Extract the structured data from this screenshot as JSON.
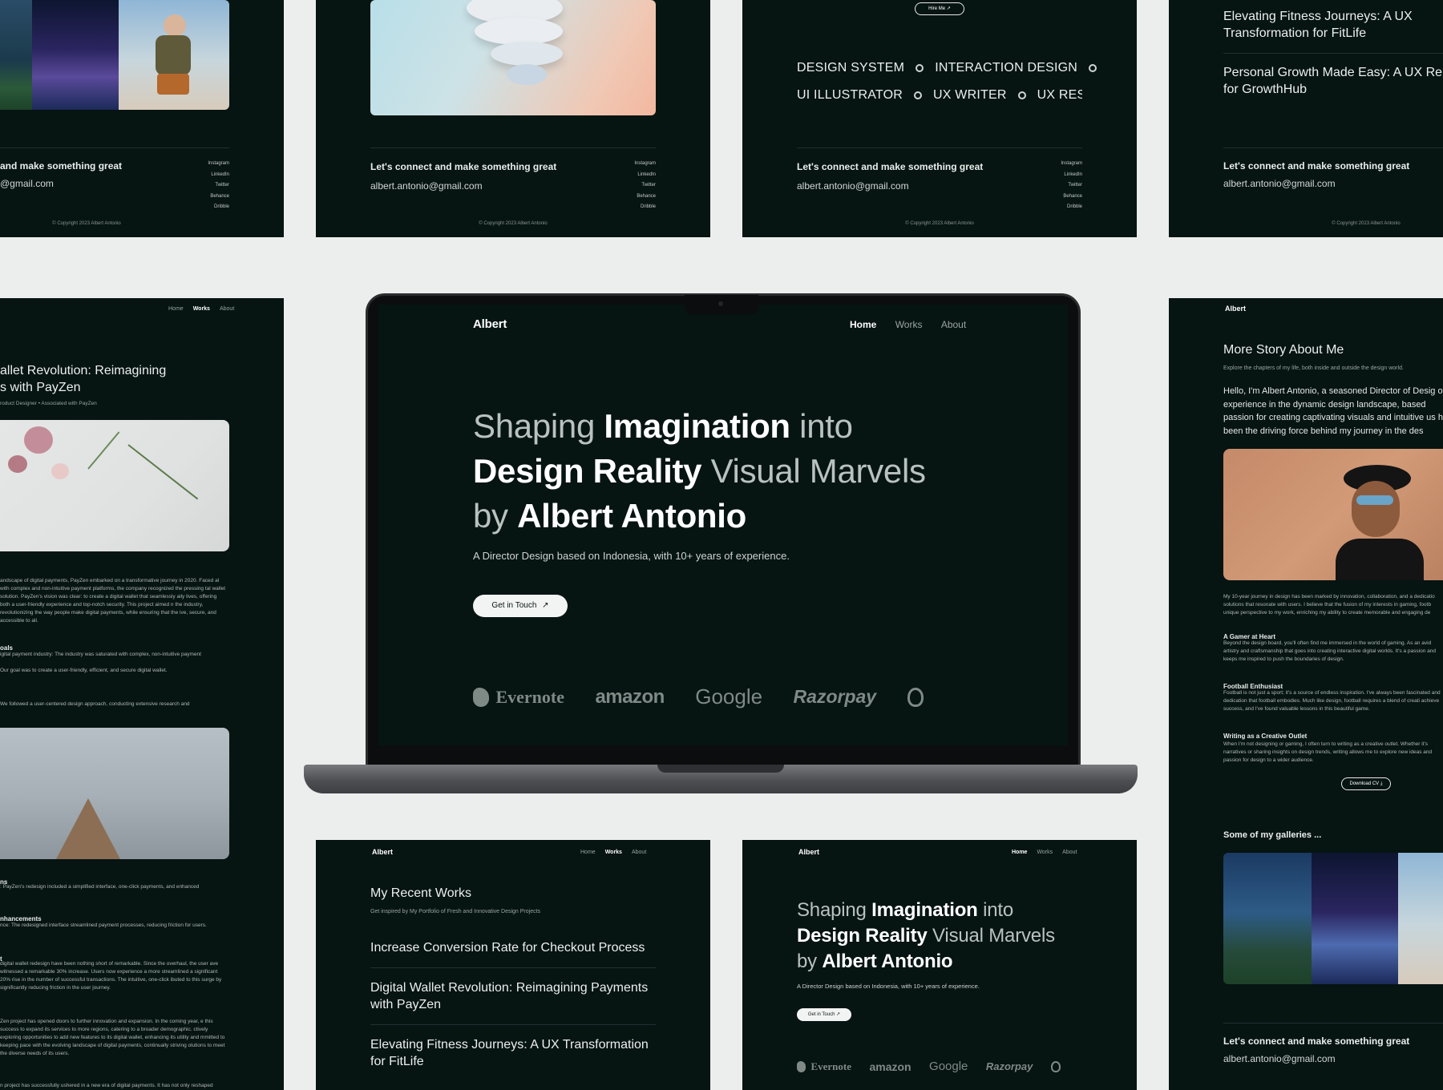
{
  "site": {
    "logo": "Albert",
    "nav": [
      "Home",
      "Works",
      "About"
    ],
    "hire_button": "Hire Me",
    "footer": {
      "cta": "Let's connect and make something great",
      "email": "albert.antonio@gmail.com",
      "social": [
        "Instagram",
        "LinkedIn",
        "Twitter",
        "Behance",
        "Dribble"
      ],
      "copyright": "© Copyright 2023 Albert Antonio"
    }
  },
  "hero": {
    "line1_a": "Shaping ",
    "line1_b": "Imagination",
    "line1_c": " into",
    "line2_a": "Design Reality",
    "line2_b": " Visual Marvels",
    "line3_a": "by ",
    "line3_b": "Albert Antonio",
    "subtitle": "A Director Design based on Indonesia, with 10+ years of experience.",
    "cta": "Get in Touch",
    "brands": [
      "Evernote",
      "amazon",
      "Google",
      "Razorpay"
    ]
  },
  "tags": {
    "row1": [
      "DESIGN SYSTEM",
      "INTERACTION DESIGN"
    ],
    "row2": [
      "UI ILLUSTRATOR",
      "UX WRITER",
      "UX RESEA"
    ]
  },
  "works": {
    "title": "My Recent Works",
    "subtitle": "Get inspired by My Portfolio of Fresh and Innovative Design Projects",
    "items": [
      "Increase Conversion Rate for Checkout Process",
      "Digital Wallet Revolution: Reimagining Payments with PayZen",
      "Elevating Fitness Journeys: A UX Transformation for FitLife"
    ]
  },
  "right_top_works": [
    "Elevating Fitness Journeys: A UX Transformation for FitLife",
    "Personal Growth Made Easy: A UX Re for GrowthHub"
  ],
  "case_study": {
    "title_l1": "allet Revolution: Reimagining",
    "title_l2": "s with PayZen",
    "meta": "roduct Designer • Associated with PayZen",
    "intro": "andscape of digital payments, PayZen embarked on a transformative journey in 2020. Faced al with complex and non-intuitive payment platforms, the company recognized the pressing tal wallet solution. PayZen's vision was clear: to create a digital wallet that seamlessly aily lives, offering both a user-friendly experience and top-notch security. This project aimed n the industry, revolutionizing the way people make digital payments, while ensuring that the ive, secure, and accessible to all.",
    "goals_h": "oals",
    "goals_1": "igital payment industry: The industry was saturated with complex, non-intuitive payment",
    "goals_2": "Our goal was to create a user-friendly, efficient, and secure digital wallet.",
    "approach": "We followed a user-centered design approach, conducting extensive research and",
    "sol_h": "ns",
    "sol_1": ": PayZen's redesign included a simplified interface, one-click payments, and enhanced",
    "enh_h": "nhancements",
    "enh_1": "nce: The redesigned interface streamlined payment processes, reducing friction for users.",
    "imp_h": "t",
    "imp_1": "digital wallet redesign have been nothing short of remarkable. Since the overhaul, the user ave witnessed a remarkable 30% increase. Users now experience a more streamlined a significant 20% rise in the number of successful transactions. The intuitive, one-click ibuted to this surge by significantly reducing friction in the user journey.",
    "fut_1": "Zen project has opened doors to further innovation and expansion. In the coming year, e this success to expand its services to more regions, catering to a broader demographic. ctively exploring opportunities to add new features to its digital wallet, enhancing its utility and mmitted to keeping pace with the evolving landscape of digital payments, continually striving olutions to meet the diverse needs of its users.",
    "end_1": "n project has successfully ushered in a new era of digital payments. It has not only reshaped"
  },
  "about": {
    "title": "More Story About Me",
    "subtitle": "Explore the chapters of my life, both inside and outside the design world.",
    "intro": "Hello, I'm Albert Antonio, a seasoned Director of Desig of experience in the dynamic design landscape, based passion for creating captivating visuals and intuitive us has been the driving force behind my journey in the des",
    "para": "My 10-year journey in design has been marked by innovation, collaboration, and a dedicatio solutions that resonate with users. I believe that the fusion of my interests in gaming, footb unique perspective to my work, enriching my ability to create memorable and engaging de",
    "gamer_h": "A Gamer at Heart",
    "gamer_p": "Beyond the design board, you'll often find me immersed in the world of gaming. As an avid artistry and craftsmanship that goes into creating interactive digital worlds. It's a passion and keeps me inspired to push the boundaries of design.",
    "foot_h": "Football Enthusiast",
    "foot_p": "Football is not just a sport; it's a source of endless inspiration. I've always been fascinated and dedication that football embodies. Much like design, football requires a blend of creati achieve success, and I've found valuable lessons in this beautiful game.",
    "write_h": "Writing as a Creative Outlet",
    "write_p": "When I'm not designing or gaming, I often turn to writing as a creative outlet. Whether it's narratives or sharing insights on design trends, writing allows me to explore new ideas and passion for design to a wider audience.",
    "download": "Download CV",
    "galleries": "Some of my galleries ..."
  },
  "top_left_footer": {
    "cta": "and make something great",
    "email": "@gmail.com"
  },
  "colors": {
    "page_bg": "#eceeed",
    "card_bg": "#061412",
    "accent_text": "#ffffff"
  }
}
